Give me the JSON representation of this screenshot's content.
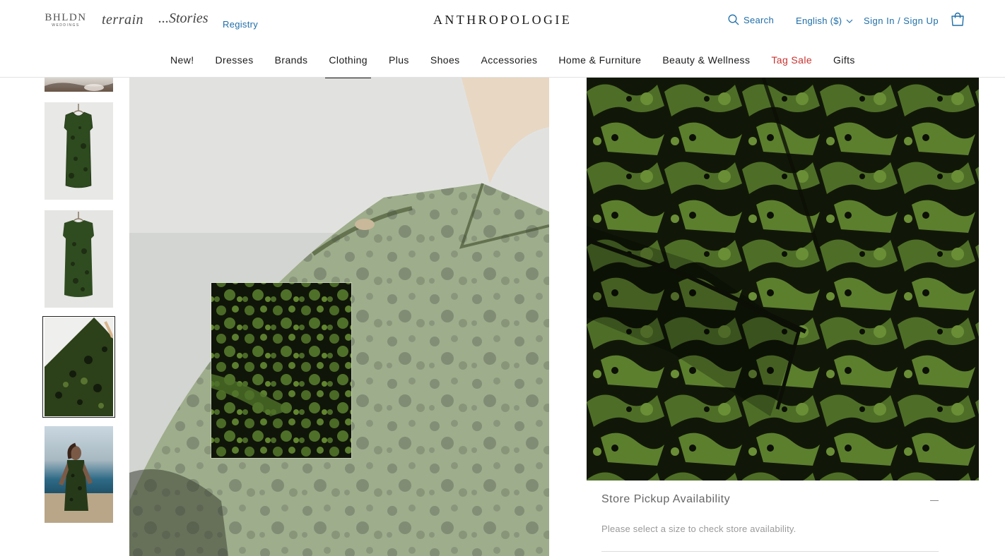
{
  "header": {
    "brands": {
      "bhldn": "BHLDN",
      "bhldn_sub": "WEDDINGS",
      "terrain": "terrain",
      "stories": "...Stories"
    },
    "registry": "Registry",
    "logo": "ANTHROPOLOGIE",
    "search": "Search",
    "language": "English ($)",
    "signin": "Sign In / Sign Up",
    "icons": [
      "search-icon",
      "chevron-down-icon",
      "shopping-bag-icon"
    ],
    "link_color": "#1e6ea8"
  },
  "nav": {
    "items": [
      "New!",
      "Dresses",
      "Brands",
      "Clothing",
      "Plus",
      "Shoes",
      "Accessories",
      "Home & Furniture",
      "Beauty & Wellness",
      "Tag Sale",
      "Gifts"
    ],
    "active": "Clothing",
    "sale_color": "#c8322f"
  },
  "gallery": {
    "selected_thumbnail": 4,
    "thumbnail_count": 5
  },
  "pickup": {
    "title": "Store Pickup Availability",
    "note": "Please select a size to check store availability."
  }
}
